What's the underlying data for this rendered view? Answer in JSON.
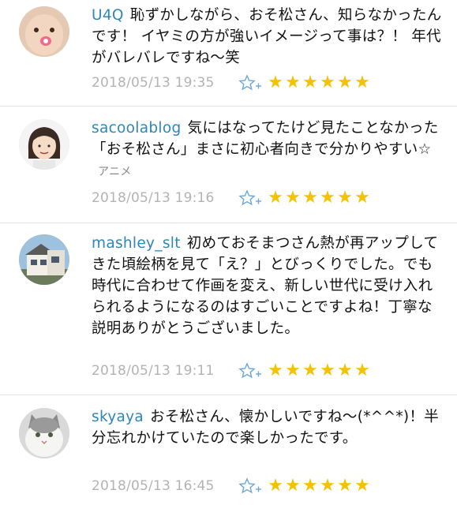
{
  "colors": {
    "username": "#2e86b8",
    "date": "#b3b3b3",
    "star": "#f3c200",
    "fav_icon": "#6aa6d8"
  },
  "comments": [
    {
      "user": "U4Q",
      "text": "恥ずかしながら、おそ松さん、知らなかったんです！ イヤミの方が強いイメージって事は？！ 年代がバレバレですね〜笑",
      "tag": "",
      "date": "2018/05/13 19:35",
      "fav_icon": "star-plus-icon",
      "rating": 6
    },
    {
      "user": "sacoolablog",
      "text": "気にはなってたけど見たことなかった「おそ松さん」まさに初心者向きで分かりやすい☆",
      "tag": "アニメ",
      "date": "2018/05/13 19:16",
      "fav_icon": "star-plus-icon",
      "rating": 6
    },
    {
      "user": "mashley_slt",
      "text": "初めておそまつさん熱が再アップしてきた頃絵柄を見て「え？」とびっくりでした。でも時代に合わせて作画を変え、新しい世代に受け入れられるようになるのはすごいことですよね！丁寧な説明ありがとうございました。",
      "tag": "",
      "date": "2018/05/13 19:11",
      "fav_icon": "star-plus-icon",
      "rating": 6
    },
    {
      "user": "skyaya",
      "text": "おそ松さん、懐かしいですね〜(*^^*)！半分忘れかけていたので楽しかったです。",
      "tag": "",
      "date": "2018/05/13 16:45",
      "fav_icon": "star-plus-icon",
      "rating": 6
    }
  ]
}
